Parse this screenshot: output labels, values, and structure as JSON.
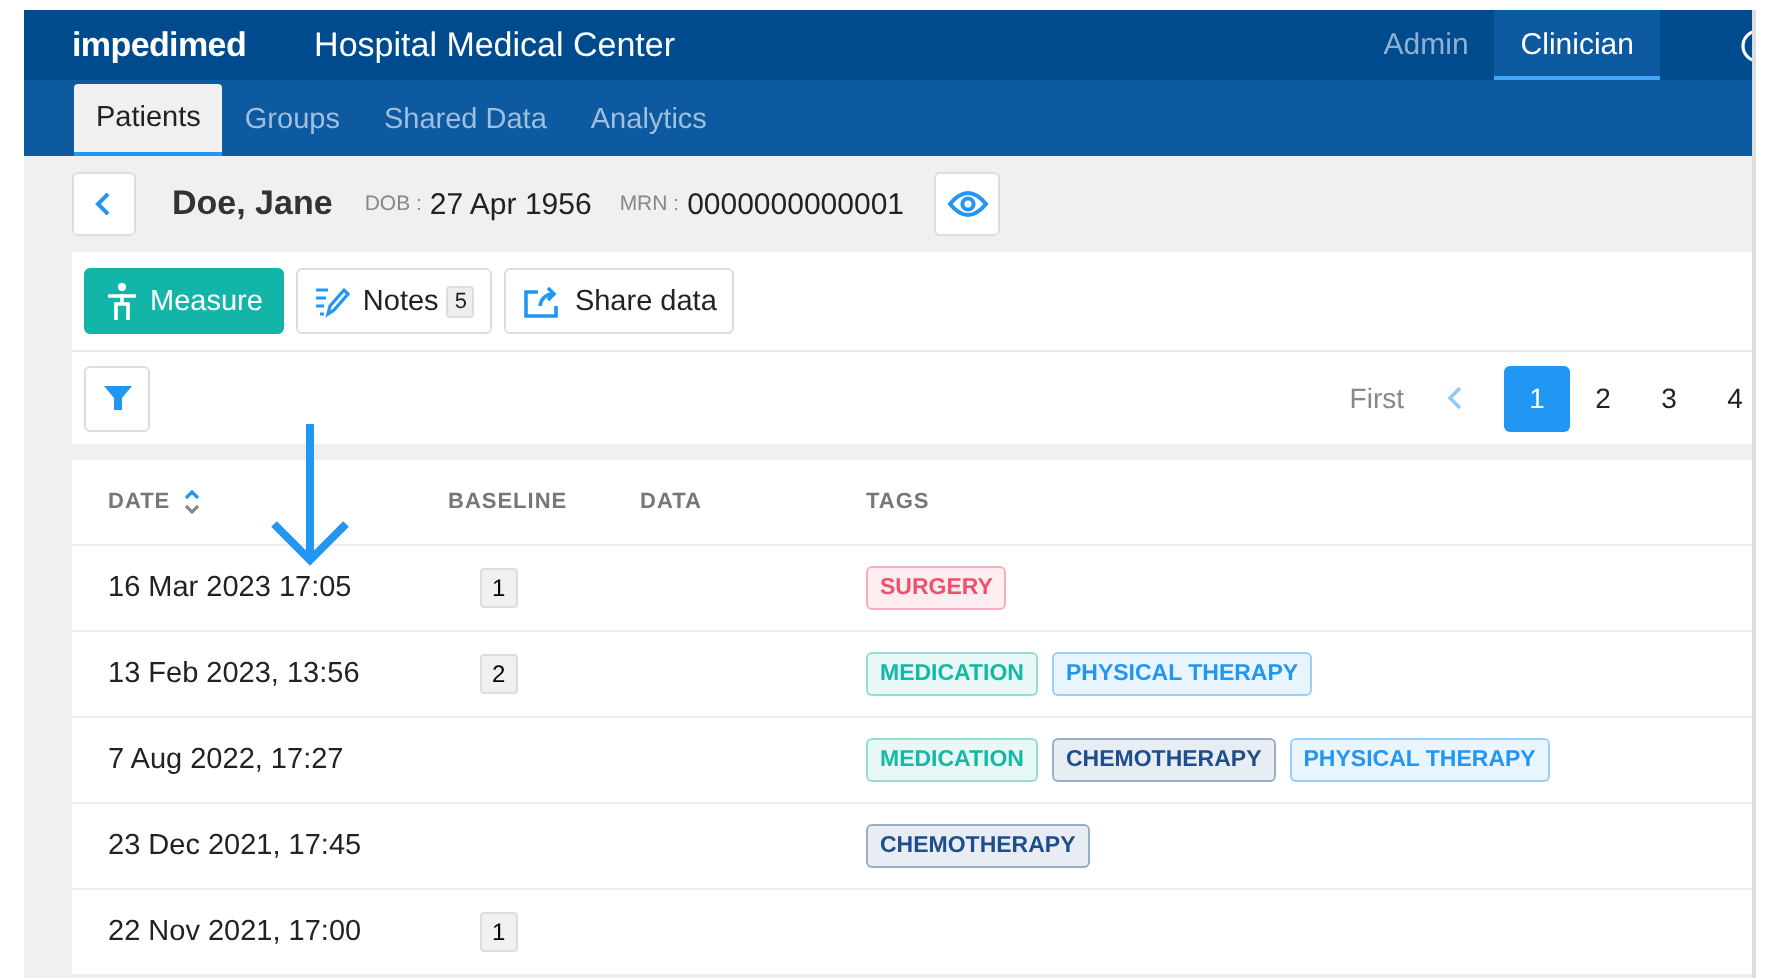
{
  "header": {
    "logo": "impedimed",
    "title": "Hospital Medical Center",
    "roles": [
      {
        "label": "Admin",
        "selected": false
      },
      {
        "label": "Clinician",
        "selected": true
      }
    ]
  },
  "tabs": [
    {
      "label": "Patients",
      "selected": true
    },
    {
      "label": "Groups",
      "selected": false
    },
    {
      "label": "Shared Data",
      "selected": false
    },
    {
      "label": "Analytics",
      "selected": false
    }
  ],
  "patient": {
    "name": "Doe, Jane",
    "dob_label": "DOB :",
    "dob": "27 Apr 1956",
    "mrn_label": "MRN :",
    "mrn": "0000000000001"
  },
  "toolbar": {
    "measure": "Measure",
    "notes": "Notes",
    "notes_count": "5",
    "share": "Share data"
  },
  "pagination": {
    "first": "First",
    "pages": [
      {
        "label": "1",
        "selected": true
      },
      {
        "label": "2",
        "selected": false
      },
      {
        "label": "3",
        "selected": false
      },
      {
        "label": "4",
        "selected": false
      }
    ]
  },
  "table": {
    "columns": [
      "DATE",
      "BASELINE",
      "DATA",
      "TAGS"
    ],
    "rows": [
      {
        "date": "16 Mar 2023 17:05",
        "baseline": "1",
        "tags": [
          {
            "label": "SURGERY",
            "color": "#f0506e"
          }
        ]
      },
      {
        "date": "13 Feb 2023, 13:56",
        "baseline": "2",
        "tags": [
          {
            "label": "MEDICATION",
            "color": "#14b8a6"
          },
          {
            "label": "PHYSICAL THERAPY",
            "color": "#2196f3"
          }
        ]
      },
      {
        "date": "7 Aug 2022, 17:27",
        "tags": [
          {
            "label": "MEDICATION",
            "color": "#14b8a6"
          },
          {
            "label": "CHEMOTHERAPY",
            "color": "#1e4d8c"
          },
          {
            "label": "PHYSICAL THERAPY",
            "color": "#2196f3"
          }
        ]
      },
      {
        "date": "23 Dec 2021, 17:45",
        "tags": [
          {
            "label": "CHEMOTHERAPY",
            "color": "#1e4d8c"
          }
        ]
      },
      {
        "date": "22 Nov 2021, 17:00",
        "baseline": "1",
        "tags": []
      }
    ]
  }
}
